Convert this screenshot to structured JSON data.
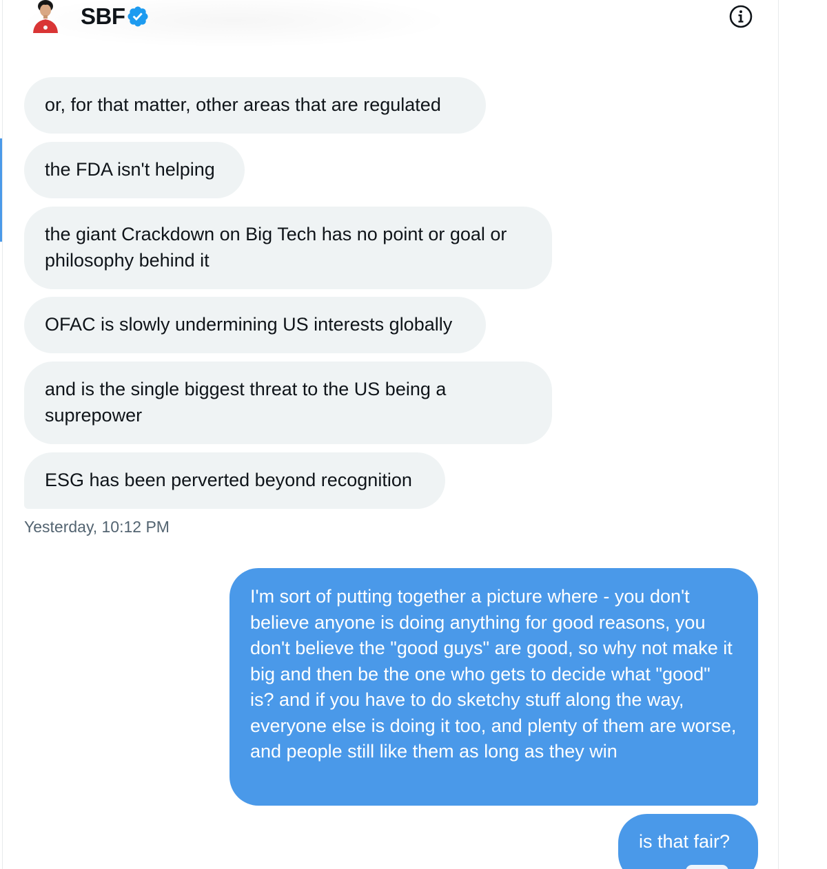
{
  "conversation": {
    "participant_name": "SBF",
    "verified": true,
    "info_icon": "info-icon"
  },
  "messages_incoming": [
    {
      "text": "or, for that matter, other areas that are regulated"
    },
    {
      "text": "the FDA isn't helping"
    },
    {
      "text": "the giant Crackdown on Big Tech has no point or goal or philosophy behind it"
    },
    {
      "text": "OFAC is slowly undermining US interests globally"
    },
    {
      "text": "and is the single biggest threat to the US being a suprepower"
    },
    {
      "text": "ESG has been perverted beyond recognition"
    }
  ],
  "incoming_timestamp": "Yesterday, 10:12 PM",
  "messages_outgoing": [
    {
      "text": "I'm sort of putting together a picture where - you don't believe anyone is doing anything for good reasons, you don't believe the \"good guys\" are good, so why not make it big and then be the one who gets to decide what \"good\" is? and if you have to do sketchy stuff along the way, everyone else is doing it too, and plenty of them are worse, and people still like them as long as they win"
    },
    {
      "text": "is that fair?"
    }
  ],
  "colors": {
    "outgoing_bubble": "#4a99e9",
    "incoming_bubble": "#eff3f4",
    "verified_badge": "#1d9bf0",
    "timestamp_text": "#536471"
  }
}
